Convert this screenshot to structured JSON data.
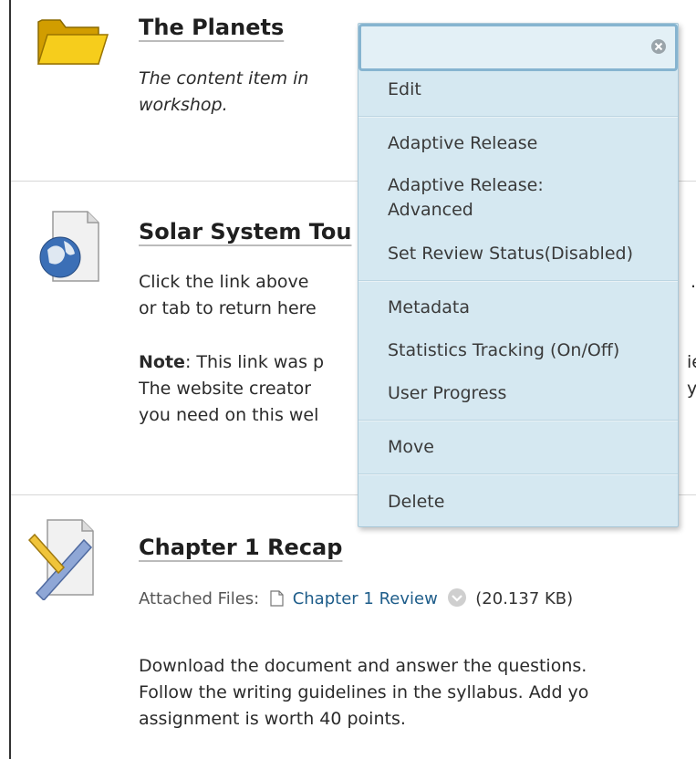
{
  "items": [
    {
      "title": "The Planets",
      "lines": [
        "The content item in",
        "workshop."
      ]
    },
    {
      "title": "Solar System Tou",
      "lines": [
        "Click the link above",
        "or tab to return here"
      ],
      "note_label": "Note",
      "note_first_line_rest": ": This link was p",
      "note_lines": [
        "The website creator",
        "you need on this wel"
      ],
      "right_fragments": [
        ".",
        "ie",
        "y"
      ]
    },
    {
      "title": "Chapter 1 Recap",
      "attached_label": "Attached Files:",
      "file_name": "Chapter 1 Review",
      "file_size": "(20.137 KB)",
      "lines": [
        "Download the document and answer the questions.",
        "Follow the writing guidelines in the syllabus. Add yo",
        "assignment is worth 40 points."
      ]
    }
  ],
  "menu": {
    "search_value": "",
    "items": [
      "Edit",
      "Adaptive Release",
      "Adaptive Release:",
      "Advanced",
      "Set Review Status(Disabled)",
      "Metadata",
      "Statistics Tracking (On/Off)",
      "User Progress",
      "Move",
      "Delete"
    ]
  },
  "colors": {
    "menu_bg": "#d5e8f1",
    "link": "#1e5d8a",
    "folder": "#f2c200"
  },
  "icons": [
    "folder-icon",
    "web-link-icon",
    "assignment-icon",
    "document-icon",
    "chevron-down-icon",
    "clear-icon"
  ]
}
